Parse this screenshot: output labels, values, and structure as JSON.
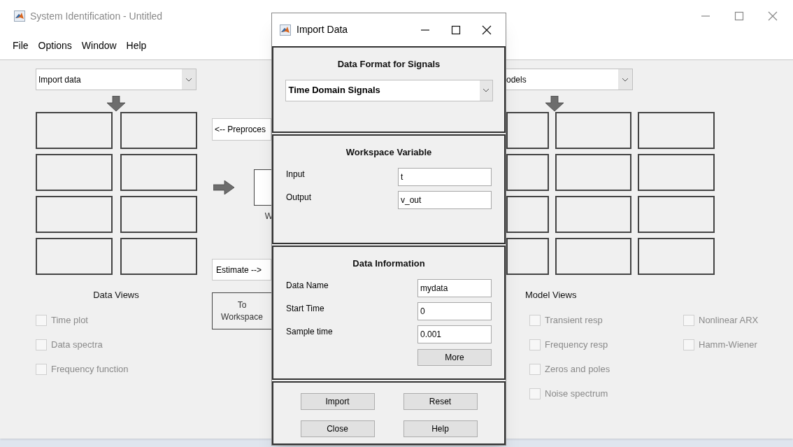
{
  "main_window": {
    "title": "System Identification - Untitled",
    "menu": [
      "File",
      "Options",
      "Window",
      "Help"
    ],
    "data_dropdown": {
      "value": "Import data"
    },
    "preprocess_button": "<-- Preproces",
    "working_data_label": "W",
    "estimate_button": "Estimate -->",
    "to_workspace_button": [
      "To",
      "Workspace"
    ],
    "data_views": {
      "title": "Data Views",
      "options": [
        {
          "label": "Time plot",
          "checked": false,
          "disabled": true
        },
        {
          "label": "Data spectra",
          "checked": false,
          "disabled": true
        },
        {
          "label": "Frequency function",
          "checked": false,
          "disabled": true
        }
      ]
    },
    "model_dropdown": {
      "value": "odels"
    },
    "model_views": {
      "title": "Model Views",
      "columns": [
        [
          {
            "label": "Transient resp",
            "checked": false,
            "disabled": true
          },
          {
            "label": "Frequency resp",
            "checked": false,
            "disabled": true
          },
          {
            "label": "Zeros and poles",
            "checked": false,
            "disabled": true
          },
          {
            "label": "Noise spectrum",
            "checked": false,
            "disabled": true
          }
        ],
        [
          {
            "label": "Nonlinear ARX",
            "checked": false,
            "disabled": true
          },
          {
            "label": "Hamm-Wiener",
            "checked": false,
            "disabled": true
          }
        ]
      ]
    }
  },
  "dialog": {
    "title": "Import Data",
    "format_panel": {
      "title": "Data Format for Signals",
      "dropdown": "Time Domain Signals"
    },
    "workspace_panel": {
      "title": "Workspace Variable",
      "fields": [
        {
          "label": "Input",
          "value": "t"
        },
        {
          "label": "Output",
          "value": "v_out"
        }
      ]
    },
    "info_panel": {
      "title": "Data Information",
      "fields": [
        {
          "label": "Data Name",
          "value": "mydata"
        },
        {
          "label": "Start Time",
          "value": "0"
        },
        {
          "label": "Sample time",
          "value": "0.001"
        }
      ],
      "more_button": "More"
    },
    "buttons": [
      "Import",
      "Reset",
      "Close",
      "Help"
    ]
  }
}
